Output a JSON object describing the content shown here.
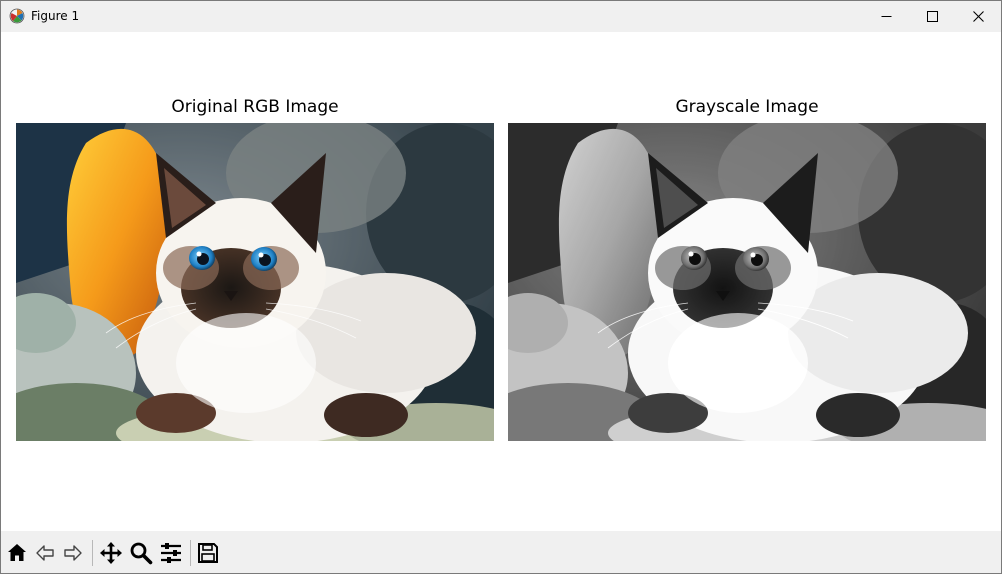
{
  "window": {
    "title": "Figure 1"
  },
  "figure": {
    "axes": [
      {
        "title": "Original RGB Image",
        "image": "kitten-photo-color"
      },
      {
        "title": "Grayscale Image",
        "image": "kitten-photo-grayscale"
      }
    ]
  },
  "toolbar": {
    "buttons": [
      {
        "name": "home",
        "icon": "home-icon"
      },
      {
        "name": "back",
        "icon": "back-arrow-icon"
      },
      {
        "name": "forward",
        "icon": "forward-arrow-icon"
      },
      {
        "name": "pan",
        "icon": "move-icon"
      },
      {
        "name": "zoom",
        "icon": "magnifier-icon"
      },
      {
        "name": "configure-subplots",
        "icon": "sliders-icon"
      },
      {
        "name": "save",
        "icon": "floppy-disk-icon"
      }
    ]
  },
  "colors": {
    "chrome": "#f0f0f0",
    "canvas": "#ffffff"
  }
}
